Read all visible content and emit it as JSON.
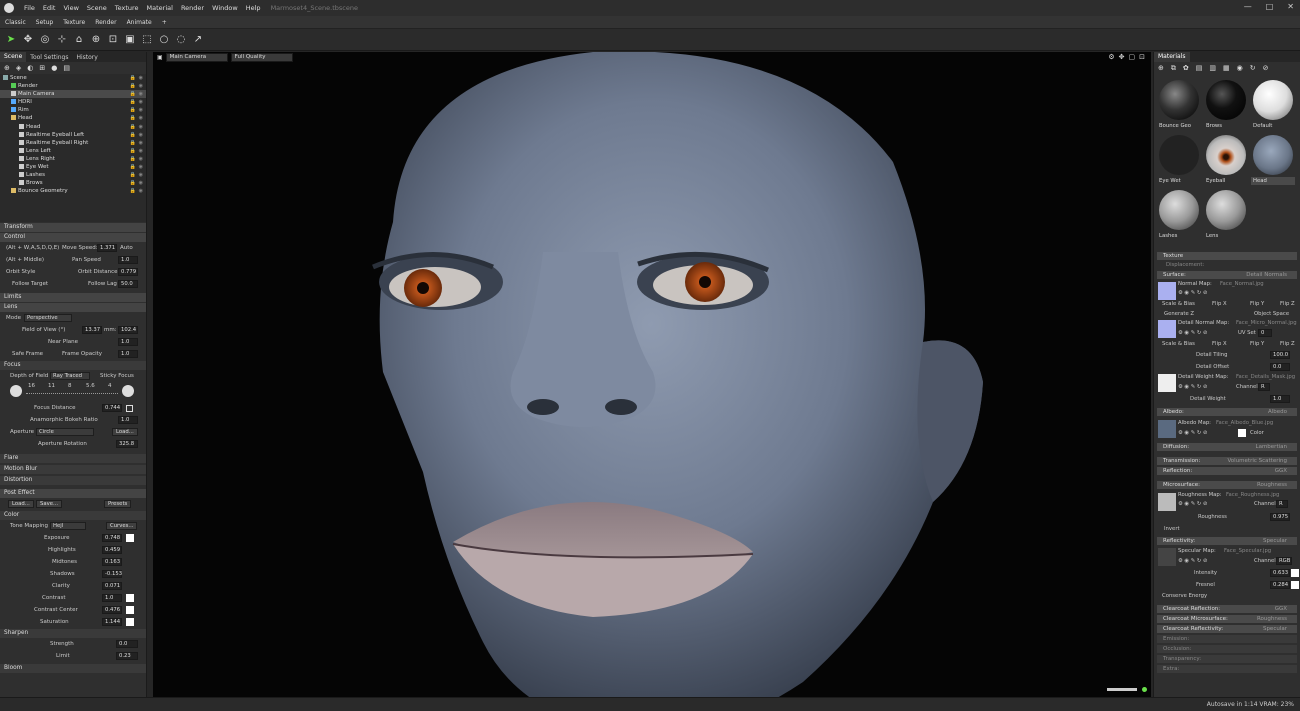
{
  "menu": {
    "items": [
      "File",
      "Edit",
      "View",
      "Scene",
      "Texture",
      "Material",
      "Render",
      "Window",
      "Help"
    ],
    "title": "Marmoset4_Scene.tbscene"
  },
  "modes": [
    "Classic",
    "Setup",
    "Texture",
    "Render",
    "Animate",
    "+"
  ],
  "left_tabs": [
    "Scene",
    "Tool Settings",
    "History"
  ],
  "tree": [
    {
      "label": "Scene",
      "indent": 0,
      "icon": "scene-icon",
      "color": "#8aa"
    },
    {
      "label": "Render",
      "indent": 1,
      "icon": "render-icon",
      "color": "#5c5"
    },
    {
      "label": "Main Camera",
      "indent": 1,
      "icon": "camera-icon",
      "color": "#ccc",
      "selected": true
    },
    {
      "label": "HDRI",
      "indent": 1,
      "icon": "sky-icon",
      "color": "#5af"
    },
    {
      "label": "Rim",
      "indent": 1,
      "icon": "light-icon",
      "color": "#5af"
    },
    {
      "label": "Head",
      "indent": 1,
      "icon": "folder-icon",
      "color": "#db6"
    },
    {
      "label": "Head",
      "indent": 2,
      "icon": "mesh-icon",
      "color": "#ccc"
    },
    {
      "label": "Realtime Eyeball Left",
      "indent": 2,
      "icon": "mesh-icon",
      "color": "#ccc"
    },
    {
      "label": "Realtime Eyeball Right",
      "indent": 2,
      "icon": "mesh-icon",
      "color": "#ccc"
    },
    {
      "label": "Lens Left",
      "indent": 2,
      "icon": "mesh-icon",
      "color": "#ccc"
    },
    {
      "label": "Lens Right",
      "indent": 2,
      "icon": "mesh-icon",
      "color": "#ccc"
    },
    {
      "label": "Eye Wet",
      "indent": 2,
      "icon": "mesh-icon",
      "color": "#ccc"
    },
    {
      "label": "Lashes",
      "indent": 2,
      "icon": "mesh-icon",
      "color": "#ccc"
    },
    {
      "label": "Brows",
      "indent": 2,
      "icon": "mesh-icon",
      "color": "#ccc"
    },
    {
      "label": "Bounce Geometry",
      "indent": 1,
      "icon": "folder-icon",
      "color": "#db6"
    }
  ],
  "sections": {
    "transform": "Transform",
    "control": "Control",
    "limits": "Limits",
    "lens": "Lens",
    "focus": "Focus",
    "flare": "Flare",
    "motion_blur": "Motion Blur",
    "distortion": "Distortion",
    "post_effect": "Post Effect",
    "color": "Color",
    "sharpen": "Sharpen",
    "bloom": "Bloom"
  },
  "control": {
    "keys1": "(Alt + W,A,S,D,Q,E)",
    "move_speed_label": "Move Speed:",
    "move_speed": "1.371",
    "auto": "Auto",
    "keys2": "(Alt + Middle)",
    "pan_speed_label": "Pan Speed",
    "pan_speed": "1.0",
    "orbit_style": "Orbit Style",
    "orbit_distance_label": "Orbit Distance",
    "orbit_distance": "0.779",
    "follow_target": "Follow Target",
    "follow_lag_label": "Follow Lag",
    "follow_lag": "50.0"
  },
  "lens": {
    "mode_label": "Mode",
    "mode": "Perspective",
    "fov_label": "Field of View (°)",
    "fov": "13.37",
    "mm_label": "mm:",
    "mm": "102.4",
    "near_plane_label": "Near Plane",
    "near_plane": "1.0",
    "safe_frame": "Safe Frame",
    "frame_opacity_label": "Frame Opacity",
    "frame_opacity": "1.0"
  },
  "focus": {
    "dof_label": "Depth of Field",
    "dof": "Ray Traced",
    "sticky": "Sticky Focus",
    "fstops": [
      "16",
      "11",
      "8",
      "5.6",
      "4"
    ],
    "focus_distance_label": "Focus Distance",
    "focus_distance": "0.744",
    "bokeh_label": "Anamorphic Bokeh Ratio",
    "bokeh": "1.0",
    "aperture_label": "Aperture",
    "aperture": "Circle",
    "load": "Load...",
    "aperture_rotation_label": "Aperture Rotation",
    "aperture_rotation": "325.8"
  },
  "post": {
    "load": "Load...",
    "save": "Save...",
    "presets": "Presets",
    "tone_label": "Tone Mapping",
    "tone": "Hejl",
    "curves": "Curves...",
    "exposure_label": "Exposure",
    "exposure": "0.748",
    "highlights_label": "Highlights",
    "highlights": "0.459",
    "midtones_label": "Midtones",
    "midtones": "0.163",
    "shadows_label": "Shadows",
    "shadows": "-0.153",
    "clarity_label": "Clarity",
    "clarity": "0.071",
    "contrast_label": "Contrast",
    "contrast": "1.0",
    "contrast_center_label": "Contrast Center",
    "contrast_center": "0.476",
    "saturation_label": "Saturation",
    "saturation": "1.144",
    "strength_label": "Strength",
    "strength": "0.0",
    "limit_label": "Limit",
    "limit": "0.23"
  },
  "viewport": {
    "camera": "Main Camera",
    "quality": "Full Quality"
  },
  "materials": {
    "tab": "Materials",
    "items": [
      {
        "label": "Bounce Geo",
        "style": "ball-dark"
      },
      {
        "label": "Brows",
        "style": "ball-black"
      },
      {
        "label": "Default",
        "style": "ball-white"
      },
      {
        "label": "Eye Wet",
        "style": "ball-none"
      },
      {
        "label": "Eyeball",
        "style": "ball-eye"
      },
      {
        "label": "Head",
        "style": "ball-head",
        "selected": true
      },
      {
        "label": "Lashes",
        "style": "ball-grey"
      },
      {
        "label": "Lens",
        "style": "ball-grey"
      }
    ]
  },
  "props": {
    "texture": "Texture",
    "displacement": "Displacement:",
    "surface": "Surface:",
    "surface_val": "Detail Normals",
    "normal_map_label": "Normal Map:",
    "normal_map": "Face_Normal.jpg",
    "scale_bias": "Scale & Bias",
    "flip_x": "Flip X",
    "flip_y": "Flip Y",
    "flip_z": "Flip Z",
    "generate_z": "Generate Z",
    "object_space": "Object Space",
    "detail_normal_label": "Detail Normal Map:",
    "detail_normal": "Face_Micro_Normal.jpg",
    "uv_set_label": "UV Set",
    "uv_set": "0",
    "detail_tiling_label": "Detail Tiling",
    "detail_tiling": "100.0",
    "detail_offset_label": "Detail Offset",
    "detail_offset": "0.0",
    "detail_weight_map_label": "Detail Weight Map:",
    "detail_weight_map": "Face_Details_Mask.jpg",
    "channel_label": "Channel",
    "channel_r": "R",
    "channel_rgb": "RGB",
    "detail_weight_label": "Detail Weight",
    "detail_weight": "1.0",
    "albedo": "Albedo:",
    "albedo_val": "Albedo",
    "albedo_map_label": "Albedo Map:",
    "albedo_map": "Face_Albedo_Blue.jpg",
    "color": "Color",
    "diffusion": "Diffusion:",
    "diffusion_val": "Lambertian",
    "transmission": "Transmission:",
    "transmission_val": "Volumetric Scattering",
    "reflection": "Reflection:",
    "reflection_val": "GGX",
    "microsurface": "Microsurface:",
    "microsurface_val": "Roughness",
    "roughness_map_label": "Roughness Map:",
    "roughness_map": "Face_Roughness.jpg",
    "roughness_label": "Roughness",
    "roughness": "0.975",
    "invert": "Invert",
    "reflectivity": "Reflectivity:",
    "reflectivity_val": "Specular",
    "specular_map_label": "Specular Map:",
    "specular_map": "Face_Specular.jpg",
    "intensity_label": "Intensity",
    "intensity": "0.633",
    "fresnel_label": "Fresnel",
    "fresnel": "0.284",
    "conserve": "Conserve Energy",
    "cc_reflection": "Clearcoat Reflection:",
    "cc_reflection_val": "GGX",
    "cc_micro": "Clearcoat Microsurface:",
    "cc_micro_val": "Roughness",
    "cc_reflectivity": "Clearcoat Reflectivity:",
    "cc_reflectivity_val": "Specular",
    "emission": "Emission:",
    "occlusion": "Occlusion:",
    "transparency": "Transparency:",
    "extra": "Extra:"
  },
  "status": {
    "text": "Autosave in 1:14   VRAM: 23%"
  }
}
